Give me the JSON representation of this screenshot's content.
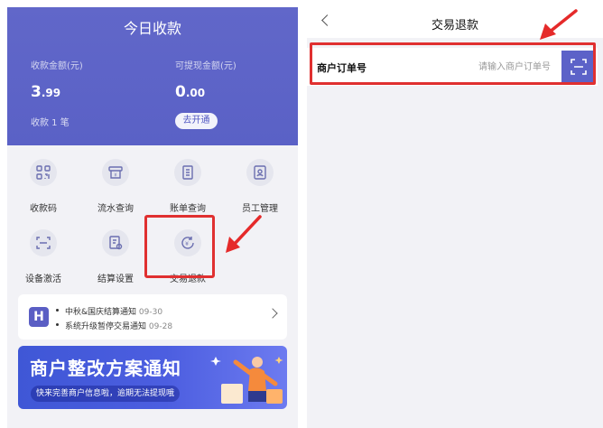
{
  "colors": {
    "brand": "#5a61c6",
    "highlight": "#e03030",
    "arrow": "#e52a2a",
    "bg": "#f2f2f6"
  },
  "home": {
    "header_title": "今日收款",
    "stats": {
      "receive_label": "收款金额(元)",
      "receive_int": "3",
      "receive_dec": ".99",
      "withdraw_label": "可提现金额(元)",
      "withdraw_int": "0",
      "withdraw_dec": ".00",
      "count_text": "收款 1 笔",
      "open_button": "去开通"
    },
    "menu": [
      {
        "label": "收款码",
        "icon": "qr-code-icon"
      },
      {
        "label": "流水查询",
        "icon": "cash-register-icon"
      },
      {
        "label": "账单查询",
        "icon": "bill-icon"
      },
      {
        "label": "员工管理",
        "icon": "employee-badge-icon"
      },
      {
        "label": "设备激活",
        "icon": "scan-frame-icon"
      },
      {
        "label": "结算设置",
        "icon": "settlement-doc-icon"
      },
      {
        "label": "交易退款",
        "icon": "refund-yen-icon"
      }
    ],
    "notices": [
      {
        "text": "中秋&国庆结算通知",
        "date": "09-30"
      },
      {
        "text": "系统升级暂停交易通知",
        "date": "09-28"
      }
    ],
    "notice_logo": "H",
    "banner": {
      "title": "商户整改方案通知",
      "subtitle": "快来完善商户信息啦，逾期无法提现哦"
    }
  },
  "refund_page": {
    "title": "交易退款",
    "order_label": "商户订单号",
    "order_placeholder": "请输入商户订单号",
    "order_value": "",
    "scan_icon": "scan-icon"
  }
}
